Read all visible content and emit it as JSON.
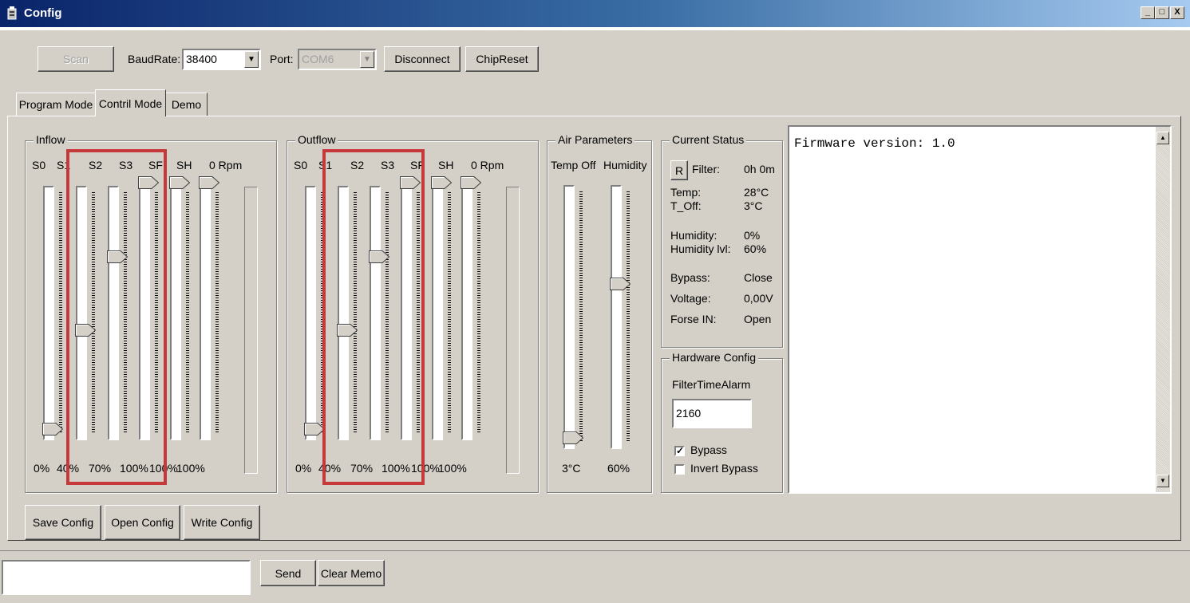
{
  "window": {
    "title": "Config",
    "min": "_",
    "max": "□",
    "close": "X"
  },
  "toolbar": {
    "scan": "Scan",
    "baud_label": "BaudRate:",
    "baud_value": "38400",
    "port_label": "Port:",
    "port_value": "COM6",
    "disconnect": "Disconnect",
    "chipreset": "ChipReset"
  },
  "tabs": [
    "Program Mode",
    "Contril Mode",
    "Demo"
  ],
  "inflow": {
    "title": "Inflow",
    "headers": [
      "S0",
      "S1",
      "S2",
      "S3",
      "SF",
      "SH",
      "0 Rpm"
    ],
    "values": [
      "0%",
      "40%",
      "70%",
      "100%",
      "100%",
      "100%"
    ],
    "levels": [
      0,
      40,
      70,
      100,
      100,
      100
    ]
  },
  "outflow": {
    "title": "Outflow",
    "headers": [
      "S0",
      "S1",
      "S2",
      "S3",
      "SF",
      "SH",
      "0 Rpm"
    ],
    "values": [
      "0%",
      "40%",
      "70%",
      "100%",
      "100%",
      "100%"
    ],
    "levels": [
      0,
      40,
      70,
      100,
      100,
      100
    ]
  },
  "air": {
    "title": "Air Parameters",
    "headers": [
      "Temp Off",
      "Humidity"
    ],
    "values": [
      "3°C",
      "60%"
    ],
    "levels": [
      0,
      60
    ]
  },
  "status": {
    "title": "Current Status",
    "reset_btn": "R",
    "filter_label": "Filter:",
    "filter_value": "0h 0m",
    "rows": [
      {
        "label": "Temp:",
        "value": "28°C"
      },
      {
        "label": "T_Off:",
        "value": "3°C"
      },
      {
        "label": "Humidity:",
        "value": "0%"
      },
      {
        "label": "Humidity lvl:",
        "value": "60%"
      },
      {
        "label": "Bypass:",
        "value": "Close"
      },
      {
        "label": "Voltage:",
        "value": "0,00V"
      },
      {
        "label": "Forse IN:",
        "value": "Open"
      }
    ]
  },
  "hardware": {
    "title": "Hardware Config",
    "filter_alarm_label": "FilterTimeAlarm",
    "filter_alarm_value": "2160",
    "bypass_label": "Bypass",
    "bypass_checked": true,
    "invert_label": "Invert Bypass",
    "invert_checked": false
  },
  "memo": {
    "text": "Firmware version: 1.0"
  },
  "config_buttons": {
    "save": "Save Config",
    "open": "Open Config",
    "write": "Write Config"
  },
  "bottom": {
    "input_value": "",
    "send": "Send",
    "clear": "Clear Memo"
  }
}
